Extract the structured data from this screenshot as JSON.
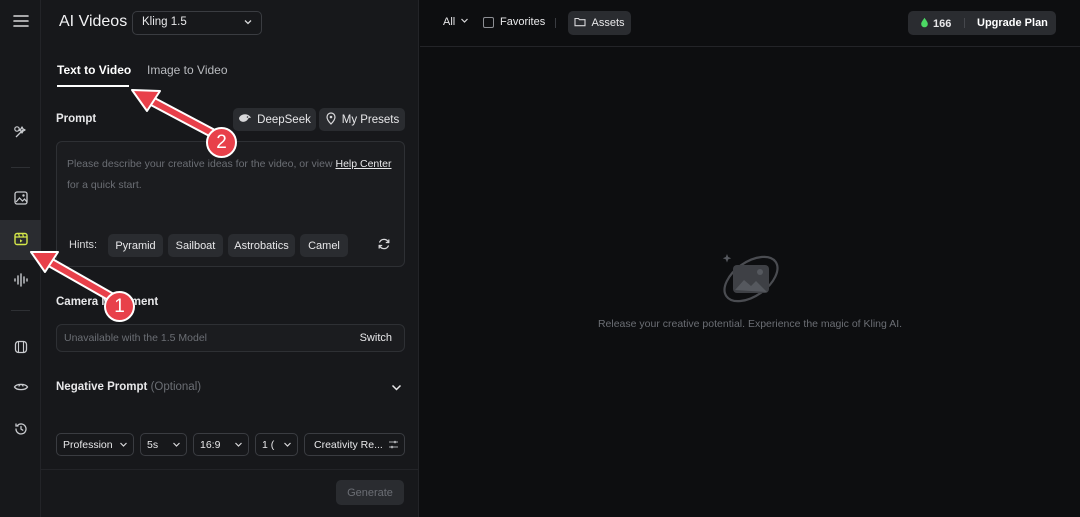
{
  "sidebar": {
    "items": [
      {
        "icon": "menu-icon"
      },
      {
        "icon": "magic-wand-icon"
      },
      {
        "icon": "image-icon"
      },
      {
        "icon": "video-icon",
        "active": true
      },
      {
        "icon": "audio-wave-icon"
      },
      {
        "icon": "model-cube-icon"
      },
      {
        "icon": "eye-icon"
      },
      {
        "icon": "history-icon"
      }
    ]
  },
  "panel": {
    "title": "AI Videos",
    "model": "Kling 1.5",
    "tabs": [
      {
        "label": "Text to Video",
        "active": true
      },
      {
        "label": "Image to Video",
        "active": false
      }
    ],
    "prompt_label": "Prompt",
    "deepseek_label": "DeepSeek",
    "presets_label": "My Presets",
    "placeholder_prefix": "Please describe your creative ideas for the video, or view",
    "help_link": "Help Center",
    "placeholder_suffix": "for a quick start.",
    "hints_label": "Hints:",
    "hints": [
      "Pyramid",
      "Sailboat",
      "Astrobatics",
      "Camel"
    ],
    "camera_label": "Camera Movement",
    "camera_placeholder": "Unavailable with the 1.5 Model",
    "camera_switch": "Switch",
    "negative_label": "Negative Prompt",
    "negative_optional": "(Optional)",
    "settings": [
      "Profession",
      "5s",
      "16:9",
      "1 (",
      "Creativity Re..."
    ],
    "generate_label": "Generate"
  },
  "topbar": {
    "filter": "All",
    "favorites": "Favorites",
    "assets": "Assets",
    "credits": "166",
    "upgrade": "Upgrade Plan"
  },
  "main": {
    "empty_text": "Release your creative potential. Experience the magic of Kling AI."
  },
  "annotations": [
    {
      "number": "1"
    },
    {
      "number": "2"
    }
  ],
  "colors": {
    "background": "#0d0e10",
    "panel": "#17181b",
    "chip": "#2a2c30",
    "annotation": "#e8404a",
    "credit_icon": "#4cd964"
  }
}
